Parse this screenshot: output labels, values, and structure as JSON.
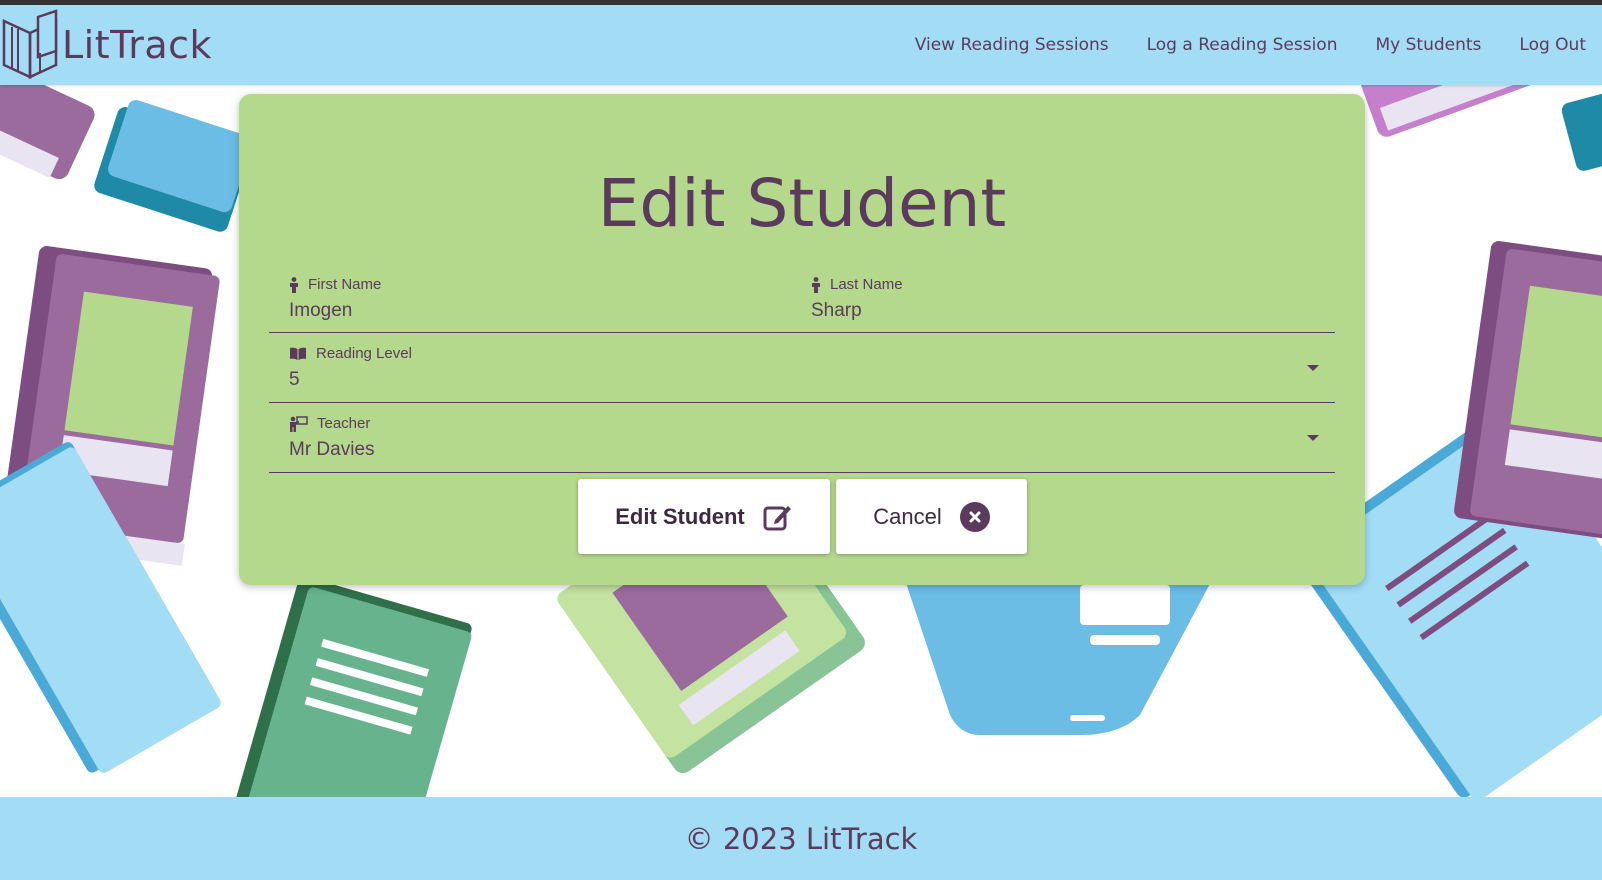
{
  "brand": {
    "name": "LitTrack"
  },
  "nav": {
    "items": [
      {
        "label": "View Reading Sessions"
      },
      {
        "label": "Log a Reading Session"
      },
      {
        "label": "My Students"
      },
      {
        "label": "Log Out"
      }
    ]
  },
  "form": {
    "title": "Edit Student",
    "first_name": {
      "label": "First Name",
      "value": "Imogen"
    },
    "last_name": {
      "label": "Last Name",
      "value": "Sharp"
    },
    "reading_level": {
      "label": "Reading Level",
      "value": "5"
    },
    "teacher": {
      "label": "Teacher",
      "value": "Mr Davies"
    },
    "submit_label": "Edit Student",
    "cancel_label": "Cancel"
  },
  "footer": {
    "text": "© 2023 LitTrack"
  },
  "colors": {
    "navbar": "#a3dcf5",
    "card": "#b5d98c",
    "text": "#5b3a5e",
    "book_purple": "#9b6b9e",
    "book_blue": "#6bbde6",
    "book_green": "#66b38e"
  },
  "icons": {
    "brand": "open-book-logo-icon",
    "first_name": "person-icon",
    "last_name": "person-icon",
    "reading_level": "book-open-icon",
    "teacher": "teacher-icon",
    "submit": "edit-square-icon",
    "cancel": "close-circle-icon"
  }
}
